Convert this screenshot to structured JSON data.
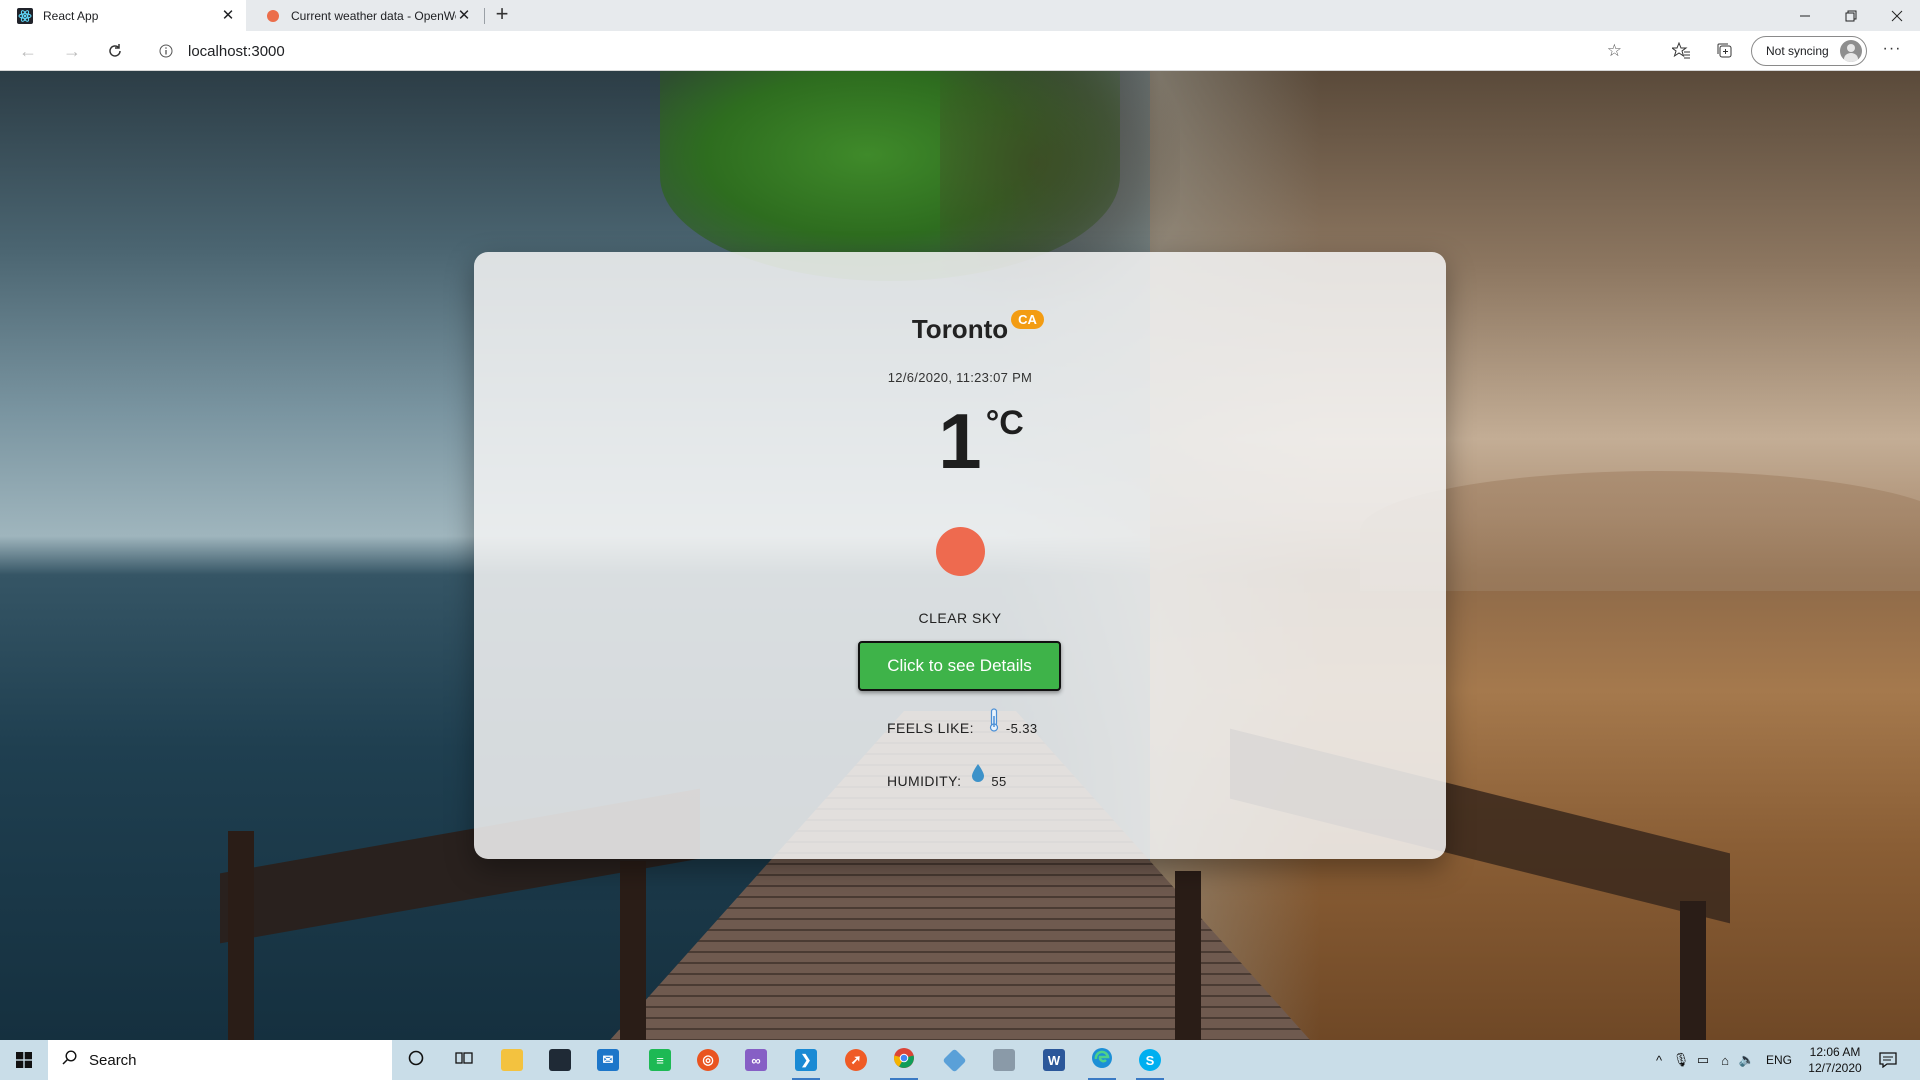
{
  "browser": {
    "tabs": [
      {
        "title": "React App",
        "active": true
      },
      {
        "title": "Current weather data - OpenWe",
        "active": false
      }
    ],
    "new_tab": "+",
    "url": "localhost:3000",
    "sync_label": "Not syncing",
    "more": "···"
  },
  "weather": {
    "city": "Toronto",
    "country": "CA",
    "datetime": "12/6/2020, 11:23:07 PM",
    "temperature": "1",
    "unit": "°C",
    "description": "CLEAR SKY",
    "details_button": "Click to see Details",
    "feels_like_label": "FEELS LIKE:",
    "feels_like_value": "-5.33",
    "humidity_label": "HUMIDITY:",
    "humidity_value": "55",
    "sun_color": "#ee6a4f",
    "button_color": "#3eb349",
    "badge_color": "#f39c12"
  },
  "taskbar": {
    "search_placeholder": "Search",
    "apps": [
      "cortana-icon",
      "task-view-icon",
      "file-explorer-icon",
      "store-icon",
      "mail-icon",
      "spotify-icon",
      "ubuntu-icon",
      "visual-studio-icon",
      "vscode-icon",
      "postman-icon",
      "chrome-icon",
      "sourcetree-icon",
      "app-icon",
      "word-icon",
      "edge-icon",
      "skype-icon"
    ],
    "language": "ENG",
    "time": "12:06 AM",
    "date": "12/7/2020"
  }
}
